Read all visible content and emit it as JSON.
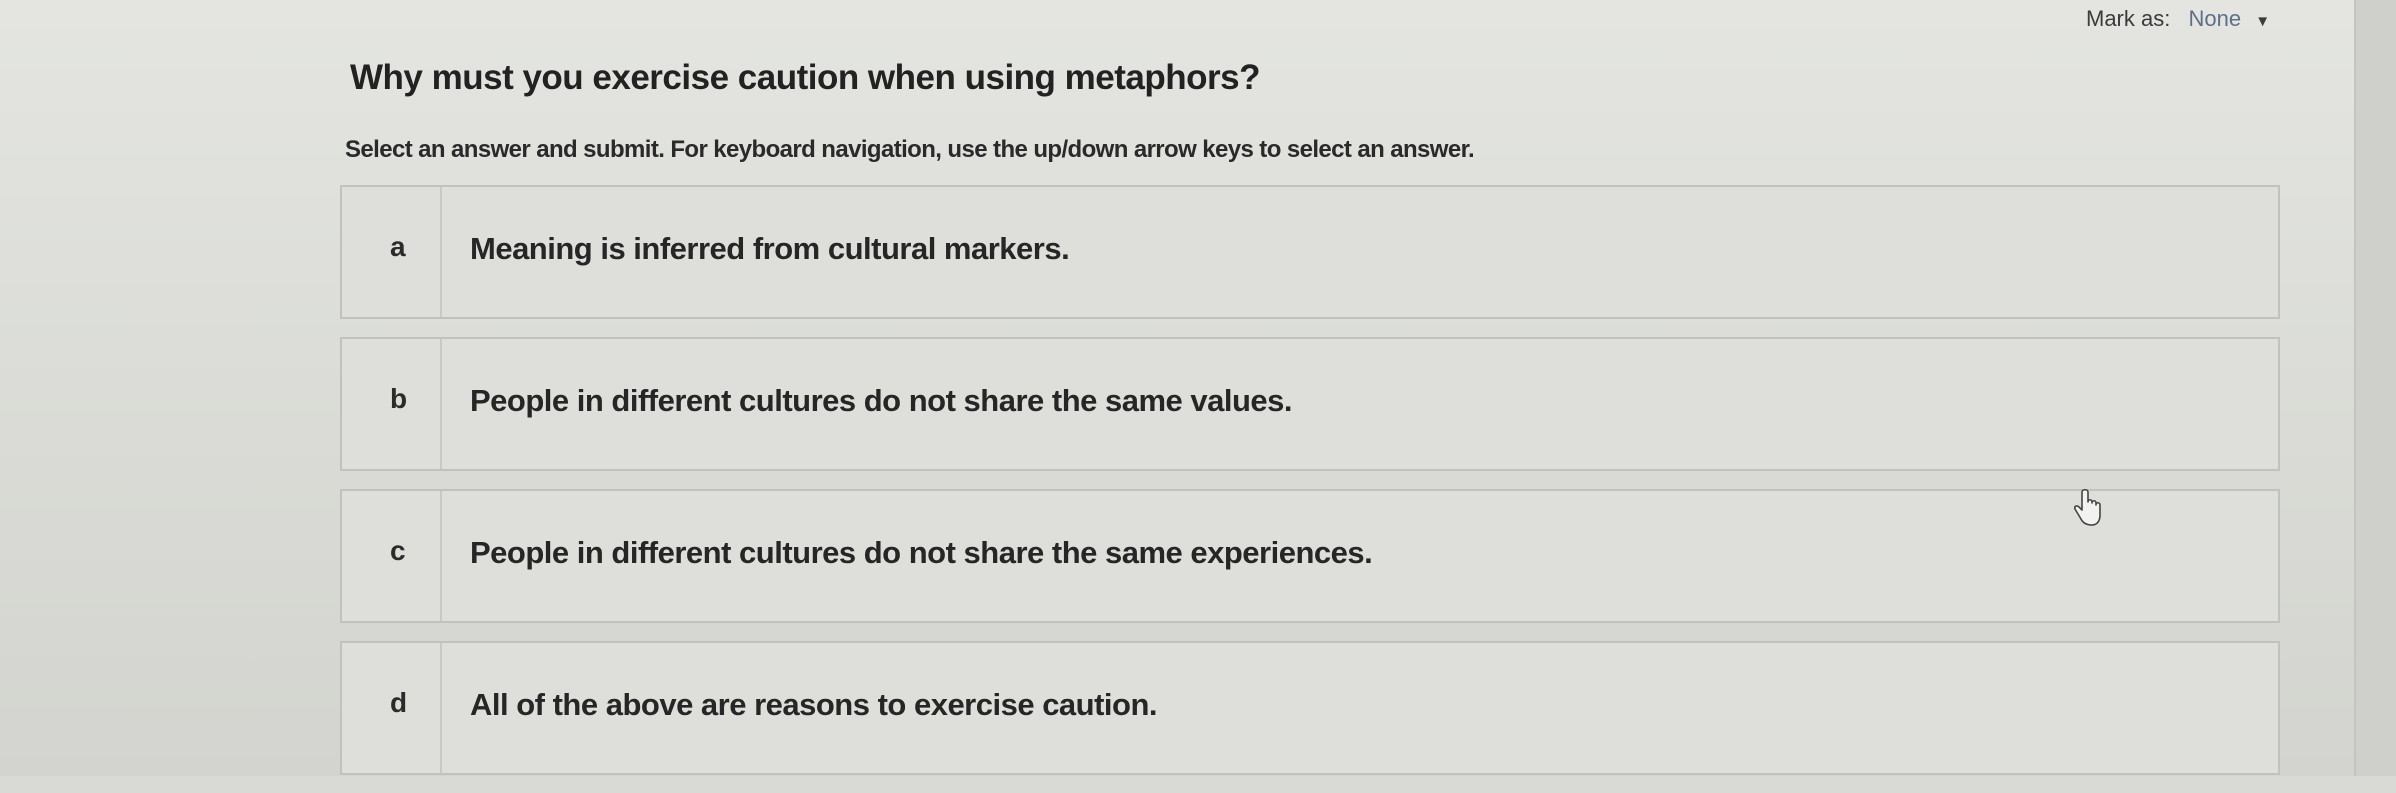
{
  "header": {
    "mark_as_label": "Mark as:",
    "mark_as_value": "None"
  },
  "question": {
    "title": "Why must you exercise caution when using metaphors?",
    "instructions": "Select an answer and submit. For keyboard navigation, use the up/down arrow keys to select an answer."
  },
  "answers": [
    {
      "letter": "a",
      "text": "Meaning is inferred from cultural markers."
    },
    {
      "letter": "b",
      "text": "People in different cultures do not share the same values."
    },
    {
      "letter": "c",
      "text": "People in different cultures do not share the same experiences."
    },
    {
      "letter": "d",
      "text": "All of the above are reasons to exercise caution."
    }
  ],
  "icons": {
    "dropdown": "chevron-down-icon",
    "pointer": "hand-cursor-icon"
  }
}
